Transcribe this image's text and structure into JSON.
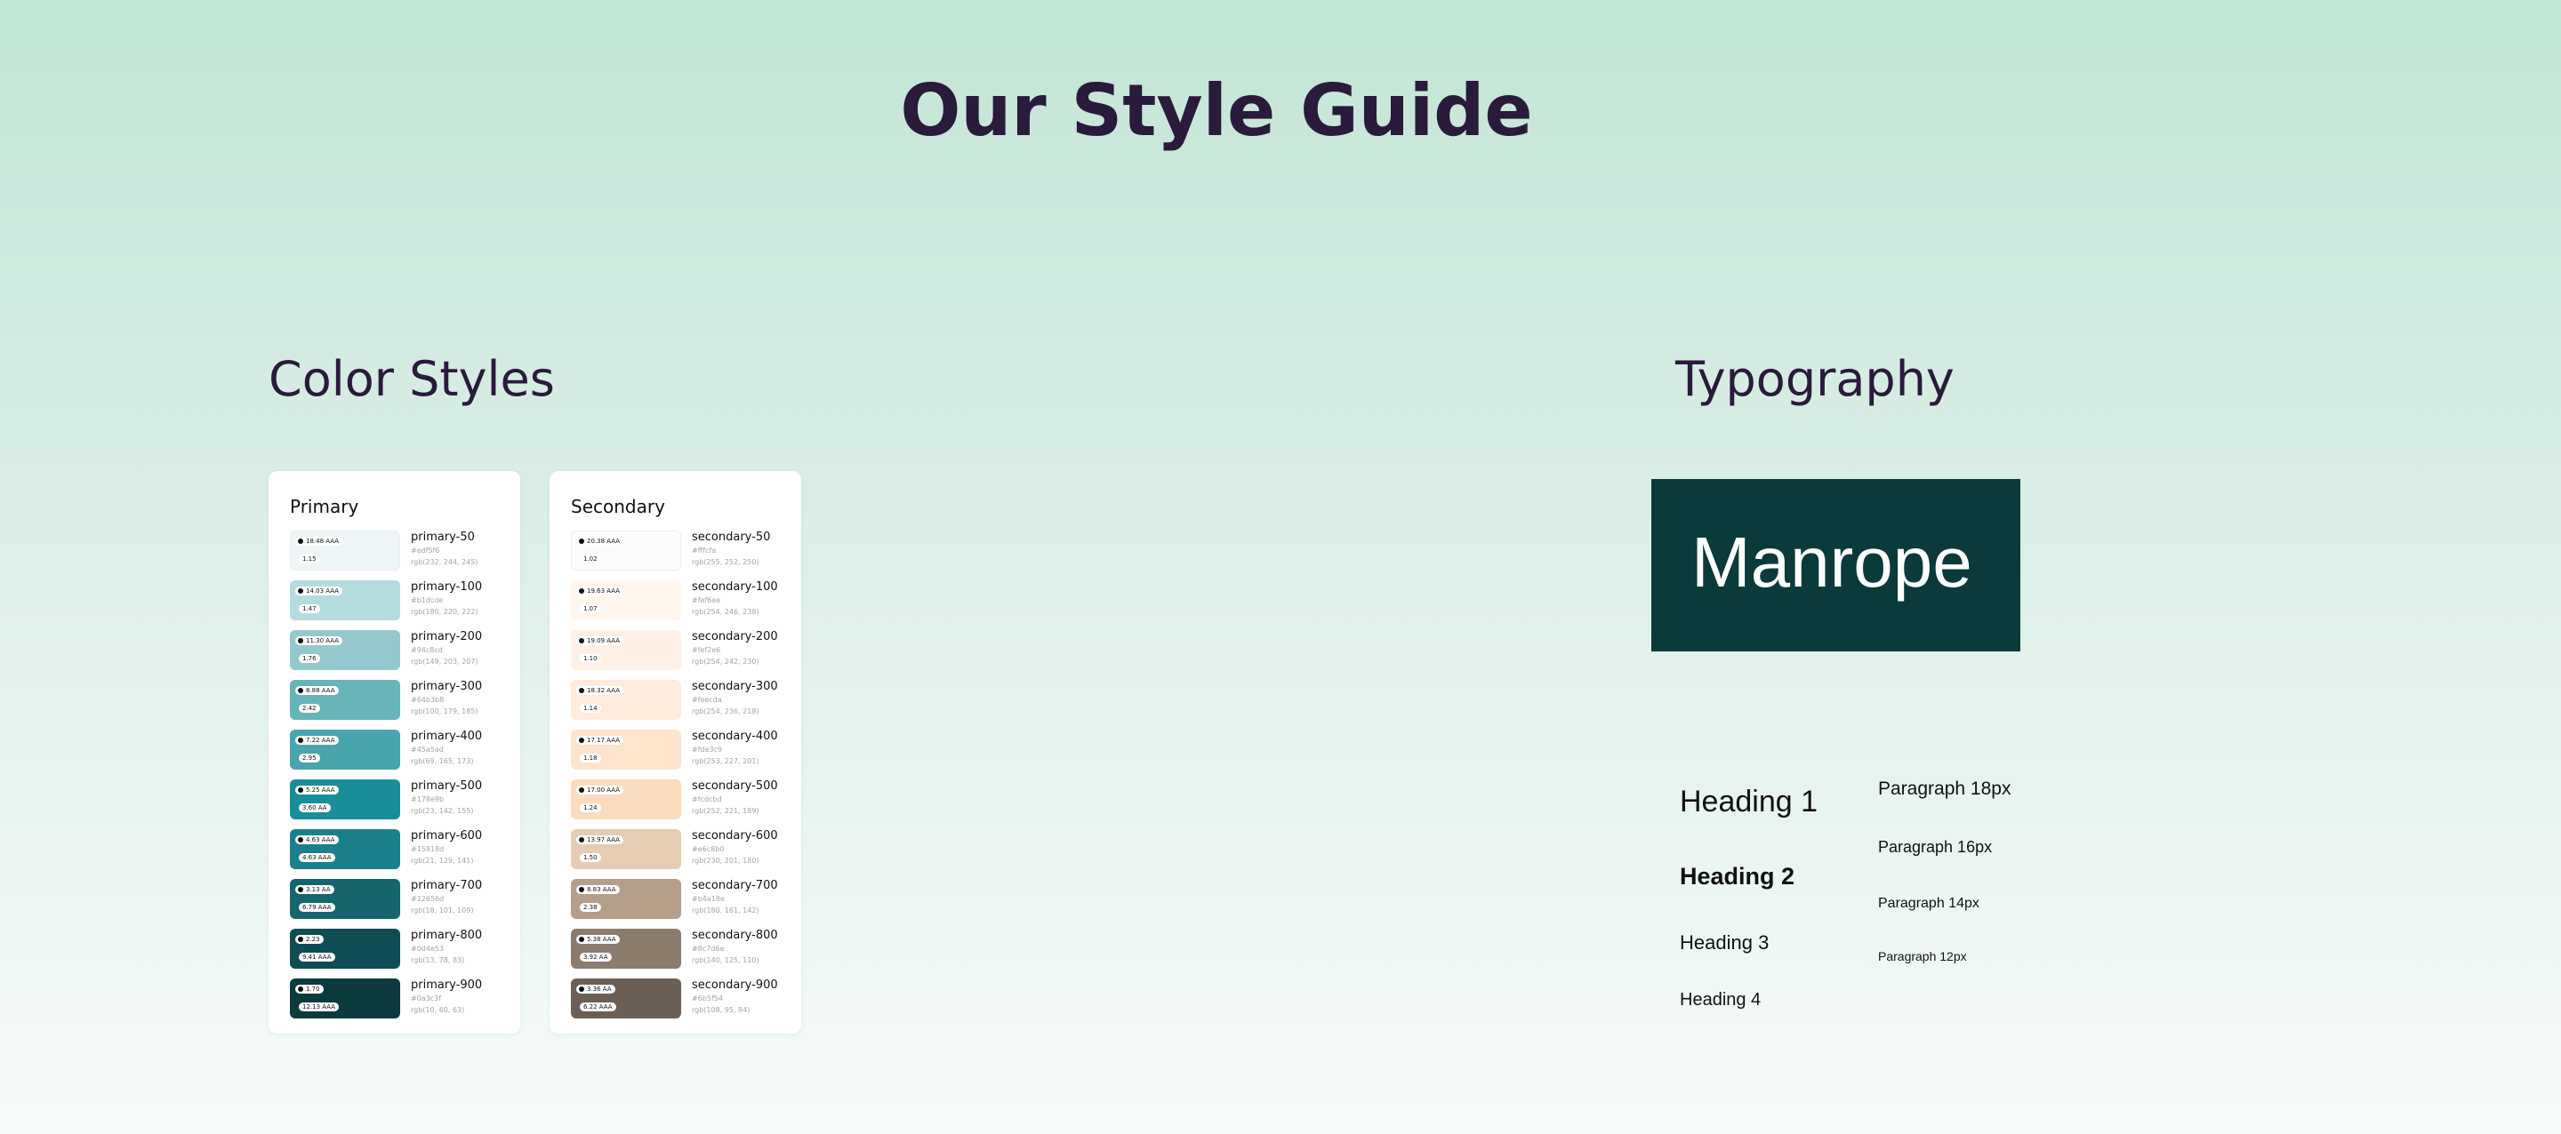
{
  "page": {
    "title": "Our Style Guide"
  },
  "colors_section": {
    "title": "Color Styles",
    "primary": {
      "title": "Primary",
      "swatches": [
        {
          "color": "#edf5f6",
          "badge1": "18.48 AAA",
          "badge2": "1.15",
          "name": "primary-50",
          "hex": "#edf5f6",
          "rgb": "rgb(232, 244, 245)"
        },
        {
          "color": "#b4dcdf",
          "badge1": "14.03 AAA",
          "badge2": "1.47",
          "name": "primary-100",
          "hex": "#b1dcde",
          "rgb": "rgb(180, 220, 222)"
        },
        {
          "color": "#95c8cd",
          "badge1": "11.30 AAA",
          "badge2": "1.76",
          "name": "primary-200",
          "hex": "#94c8cd",
          "rgb": "rgb(149, 203, 207)"
        },
        {
          "color": "#67b4b9",
          "badge1": "8.88 AAA",
          "badge2": "2.42",
          "name": "primary-300",
          "hex": "#64b3b8",
          "rgb": "rgb(100, 179, 185)"
        },
        {
          "color": "#48a5ad",
          "badge1": "7.22 AAA",
          "badge2": "2.95",
          "name": "primary-400",
          "hex": "#45a5ad",
          "rgb": "rgb(69, 165, 173)"
        },
        {
          "color": "#198e9a",
          "badge1": "5.25 AAA",
          "badge2": "3.60 AA",
          "name": "primary-500",
          "hex": "#178e9b",
          "rgb": "rgb(23, 142, 155)"
        },
        {
          "color": "#1a818c",
          "badge1": "4.63 AAA",
          "badge2": "4.63 AAA",
          "name": "primary-600",
          "hex": "#15818d",
          "rgb": "rgb(21, 129, 141)"
        },
        {
          "color": "#14656d",
          "badge1": "3.13 AA",
          "badge2": "6.79 AAA",
          "name": "primary-700",
          "hex": "#12656d",
          "rgb": "rgb(18, 101, 109)"
        },
        {
          "color": "#0e4d53",
          "badge1": "2.23",
          "badge2": "9.41 AAA",
          "name": "primary-800",
          "hex": "#0d4e53",
          "rgb": "rgb(13, 78, 83)"
        },
        {
          "color": "#0b3a3f",
          "badge1": "1.70",
          "badge2": "12.13 AAA",
          "name": "primary-900",
          "hex": "#0a3c3f",
          "rgb": "rgb(10, 60, 63)"
        }
      ]
    },
    "secondary": {
      "title": "Secondary",
      "swatches": [
        {
          "color": "#fdfcfa",
          "badge1": "20.38 AAA",
          "badge2": "1.02",
          "name": "secondary-50",
          "hex": "#fffcfa",
          "rgb": "rgb(255, 252, 250)"
        },
        {
          "color": "#fff6ee",
          "badge1": "19.63 AAA",
          "badge2": "1.07",
          "name": "secondary-100",
          "hex": "#fef6ee",
          "rgb": "rgb(254, 246, 238)"
        },
        {
          "color": "#fff0e6",
          "badge1": "19.09 AAA",
          "badge2": "1.10",
          "name": "secondary-200",
          "hex": "#fef2e6",
          "rgb": "rgb(254, 242, 230)"
        },
        {
          "color": "#feebdc",
          "badge1": "18.32 AAA",
          "badge2": "1.14",
          "name": "secondary-300",
          "hex": "#feecda",
          "rgb": "rgb(254, 236, 218)"
        },
        {
          "color": "#fde4cd",
          "badge1": "17.17 AAA",
          "badge2": "1.18",
          "name": "secondary-400",
          "hex": "#fde3c9",
          "rgb": "rgb(253, 227, 201)"
        },
        {
          "color": "#fcdcbe",
          "badge1": "17.00 AAA",
          "badge2": "1.24",
          "name": "secondary-500",
          "hex": "#fcdcbd",
          "rgb": "rgb(252, 221, 189)"
        },
        {
          "color": "#e6ccb3",
          "badge1": "13.97 AAA",
          "badge2": "1.50",
          "name": "secondary-600",
          "hex": "#e6c8b0",
          "rgb": "rgb(230, 201, 180)"
        },
        {
          "color": "#b59f8b",
          "badge1": "8.83 AAA",
          "badge2": "2.38",
          "name": "secondary-700",
          "hex": "#b4a18e",
          "rgb": "rgb(180, 161, 142)"
        },
        {
          "color": "#8c7c6e",
          "badge1": "5.38 AAA",
          "badge2": "3.92 AA",
          "name": "secondary-800",
          "hex": "#8c7d6e",
          "rgb": "rgb(140, 125, 110)"
        },
        {
          "color": "#6b5f55",
          "badge1": "3.36 AA",
          "badge2": "6.22 AAA",
          "name": "secondary-900",
          "hex": "#6b5f54",
          "rgb": "rgb(108, 95, 84)"
        }
      ]
    }
  },
  "typography": {
    "title": "Typography",
    "font_name": "Manrope",
    "font_box_color": "#0b3a3b",
    "headings": [
      "Heading 1",
      "Heading 2",
      "Heading 3",
      "Heading 4"
    ],
    "paragraphs": [
      "Paragraph 18px",
      "Paragraph 16px",
      "Paragraph 14px",
      "Paragraph 12px"
    ]
  }
}
